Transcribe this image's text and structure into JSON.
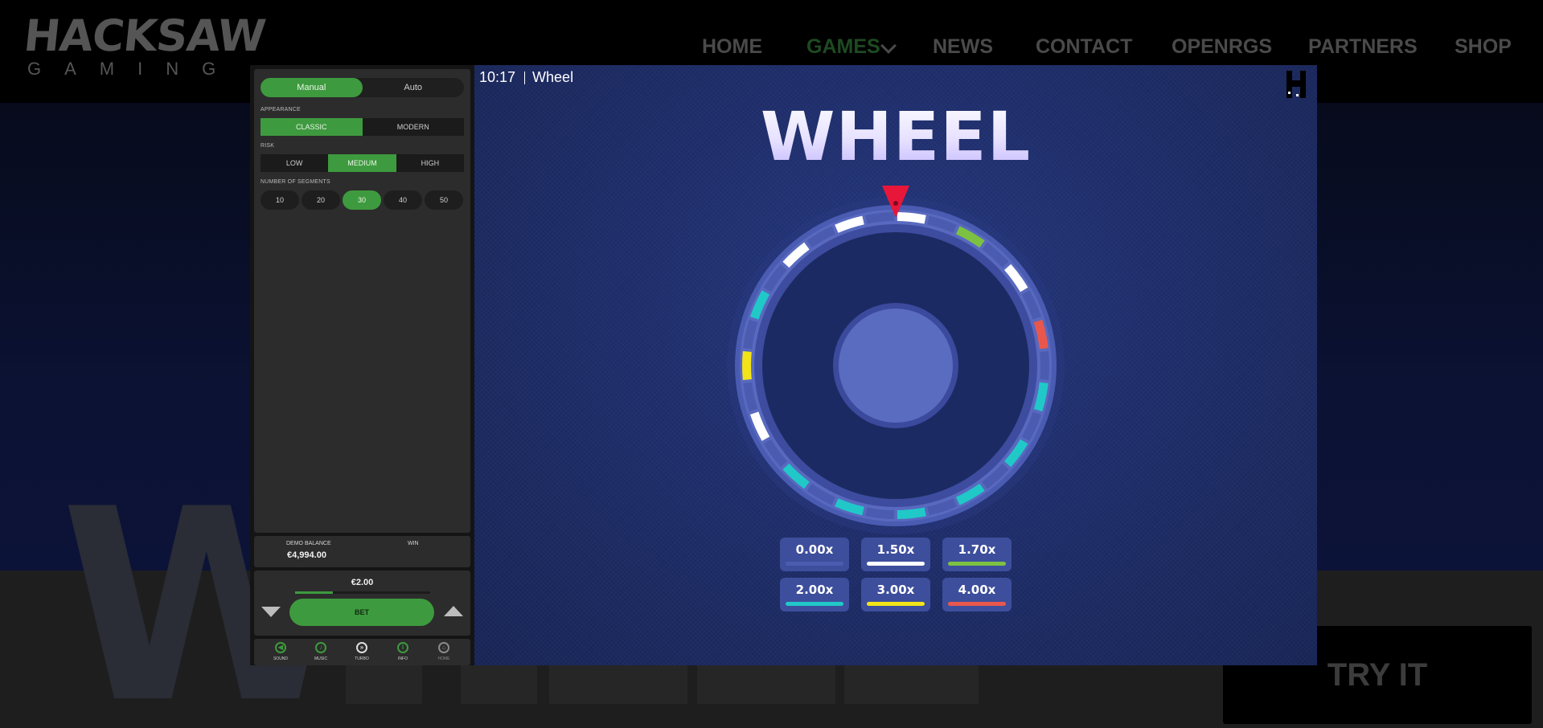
{
  "site": {
    "logo_main": "HACKSAW",
    "logo_sub": "GAMING",
    "nav": [
      "HOME",
      "GAMES",
      "NEWS",
      "CONTACT",
      "OPENRGS",
      "PARTNERS",
      "SHOP"
    ],
    "active_nav": "GAMES",
    "hero_letter": "W",
    "try_button": "TRY IT"
  },
  "controls": {
    "mode_tabs": [
      "Manual",
      "Auto"
    ],
    "mode_selected": "Manual",
    "appearance_label": "APPEARANCE",
    "appearance_options": [
      "CLASSIC",
      "MODERN"
    ],
    "appearance_selected": "CLASSIC",
    "risk_label": "RISK",
    "risk_options": [
      "LOW",
      "MEDIUM",
      "HIGH"
    ],
    "risk_selected": "MEDIUM",
    "segments_label": "NUMBER OF SEGMENTS",
    "segment_options": [
      "10",
      "20",
      "30",
      "40",
      "50"
    ],
    "segments_selected": "30"
  },
  "balance": {
    "demo_balance_label": "DEMO BALANCE",
    "demo_balance_value": "€4,994.00",
    "win_label": "WIN",
    "win_value": ""
  },
  "bet": {
    "amount": "€2.00",
    "bet_label": "BET",
    "slider_fraction": 0.28
  },
  "toolbar": {
    "items": [
      {
        "label": "SOUND",
        "icon": "sound-icon"
      },
      {
        "label": "MUSIC",
        "icon": "music-icon"
      },
      {
        "label": "TURBO",
        "icon": "turbo-icon"
      },
      {
        "label": "INFO",
        "icon": "info-icon"
      },
      {
        "label": "HOME",
        "icon": "home-icon"
      }
    ]
  },
  "game": {
    "clock": "10:17",
    "name": "Wheel",
    "title": "WHEEL",
    "multipliers": [
      {
        "value": "0.00x",
        "color": "#4b5cb0"
      },
      {
        "value": "1.50x",
        "color": "#ffffff"
      },
      {
        "value": "1.70x",
        "color": "#7cc142"
      },
      {
        "value": "2.00x",
        "color": "#21c8c8"
      },
      {
        "value": "3.00x",
        "color": "#f2e419"
      },
      {
        "value": "4.00x",
        "color": "#e9574c"
      }
    ],
    "wheel_segments": [
      "1.50x",
      "0.00x",
      "1.70x",
      "0.00x",
      "1.50x",
      "0.00x",
      "4.00x",
      "0.00x",
      "2.00x",
      "0.00x",
      "2.00x",
      "0.00x",
      "2.00x",
      "0.00x",
      "2.00x",
      "0.00x",
      "2.00x",
      "0.00x",
      "2.00x",
      "0.00x",
      "1.50x",
      "0.00x",
      "3.00x",
      "0.00x",
      "2.00x",
      "0.00x",
      "1.50x",
      "0.00x",
      "1.50x",
      "0.00x"
    ],
    "colors": {
      "accent_green": "#3e9a3e",
      "pointer": "#e8173a",
      "hub": "#5a6cbf"
    }
  }
}
